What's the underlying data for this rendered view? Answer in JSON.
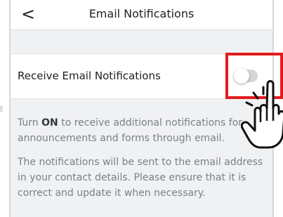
{
  "header": {
    "back_icon": "chevron-left-icon",
    "back_glyph": "<",
    "title": "Email Notifications"
  },
  "setting": {
    "label": "Receive Email Notifications",
    "toggle_on": false
  },
  "help": {
    "p1_prefix": "Turn ",
    "p1_bold": "ON",
    "p1_suffix": " to receive additional notifications for announcements and forms through email.",
    "p2": "The notifications will be sent to the email address in your contact details. Please ensure that it is correct and update it when necessary."
  },
  "overlay": {
    "highlight_color": "#e21c1c",
    "pointer_icon": "pointing-hand-icon"
  }
}
